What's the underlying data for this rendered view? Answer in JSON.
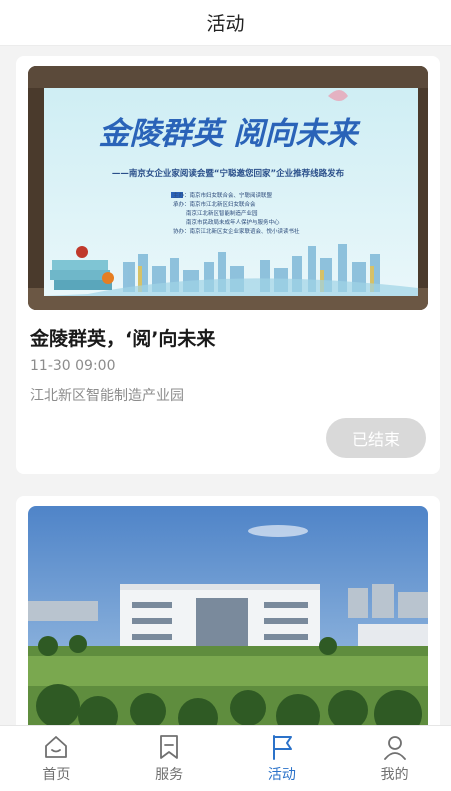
{
  "header": {
    "title": "活动"
  },
  "events": [
    {
      "banner": {
        "headline": "金陵群英 阅向未来",
        "subtitle": "——南京女企业家阅读会暨“宁聪邀您回家”企业推荐线路发布",
        "lines": [
          "主办：南京市妇女联合会、宁聪阅读联盟",
          "承办：南京市江北新区妇女联合会",
          "南京江北新区智能制造产业园",
          "南京市民政局未成年人保护与服务中心",
          "协办：南京江北新区女企业家联谊会、悦小读读书社"
        ]
      },
      "title": "金陵群英，‘阅’向未来",
      "time": "11-30 09:00",
      "place": "江北新区智能制造产业园",
      "status": "已结束"
    },
    {
      "image": "building-photo"
    }
  ],
  "tabs": [
    {
      "label": "首页",
      "icon": "home-icon",
      "active": false
    },
    {
      "label": "服务",
      "icon": "bookmark-icon",
      "active": false
    },
    {
      "label": "活动",
      "icon": "flag-icon",
      "active": true
    },
    {
      "label": "我的",
      "icon": "user-icon",
      "active": false
    }
  ],
  "colors": {
    "accent": "#2b72c9",
    "ended_button": "#d9d9d9",
    "muted_text": "#8c8c8c"
  }
}
